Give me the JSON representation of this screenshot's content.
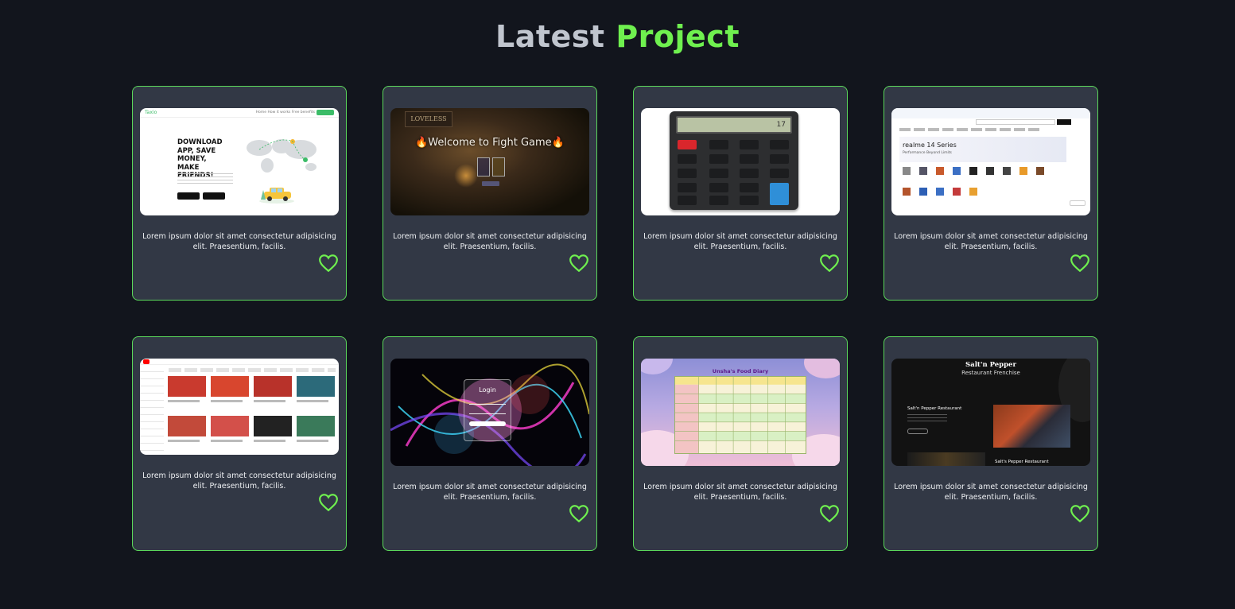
{
  "heading": {
    "part1": "Latest",
    "part2": "Project"
  },
  "colors": {
    "accent": "#6ff04f",
    "card_border": "#5bd85b",
    "card_bg": "#323845",
    "page_bg": "#12151d"
  },
  "projects": [
    {
      "description": "Lorem ipsum dolor sit amet consectetur adipisicing elit. Praesentium, facilis.",
      "icon": "heart-icon",
      "thumb": {
        "logo": "Taxio",
        "nav": "Home  How it works  Free benefits",
        "headline": "DOWNLOAD APP, SAVE MONEY, MAKE FRIENDS!"
      }
    },
    {
      "description": "Lorem ipsum dolor sit amet consectetur adipisicing elit. Praesentium, facilis.",
      "icon": "heart-icon",
      "thumb": {
        "sign": "LOVELESS",
        "title": "🔥Welcome to Fight Game🔥"
      }
    },
    {
      "description": "Lorem ipsum dolor sit amet consectetur adipisicing elit. Praesentium, facilis.",
      "icon": "heart-icon",
      "thumb": {
        "display": "17"
      }
    },
    {
      "description": "Lorem ipsum dolor sit amet consectetur adipisicing elit. Praesentium, facilis.",
      "icon": "heart-icon",
      "thumb": {
        "banner_title": "realme 14 Series",
        "banner_sub": "Performance Beyond Limits"
      }
    },
    {
      "description": "Lorem ipsum dolor sit amet consectetur adipisicing elit. Praesentium, facilis.",
      "icon": "heart-icon",
      "thumb": {}
    },
    {
      "description": "Lorem ipsum dolor sit amet consectetur adipisicing elit. Praesentium, facilis.",
      "icon": "heart-icon",
      "thumb": {
        "title": "Login"
      }
    },
    {
      "description": "Lorem ipsum dolor sit amet consectetur adipisicing elit. Praesentium, facilis.",
      "icon": "heart-icon",
      "thumb": {
        "title": "Unsha's Food Diary"
      }
    },
    {
      "description": "Lorem ipsum dolor sit amet consectetur adipisicing elit. Praesentium, facilis.",
      "icon": "heart-icon",
      "thumb": {
        "brand": "Salt'n Pepper",
        "subtitle": "Restaurant Frenchise",
        "branch1": "Salt'n Pepper Restaurant",
        "branch2": "Salt's Pepper Restaurant"
      }
    }
  ]
}
